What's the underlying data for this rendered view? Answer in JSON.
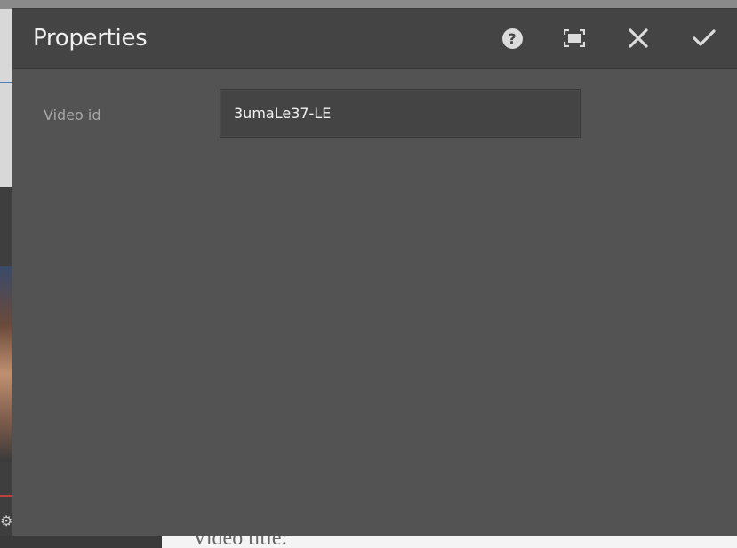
{
  "dialog": {
    "title": "Properties",
    "buttons": {
      "help": "help-icon",
      "fullscreen": "fullscreen-icon",
      "close": "close-icon",
      "done": "checkmark-icon"
    }
  },
  "form": {
    "video_id": {
      "label": "Video id",
      "value": "3umaLe37-LE"
    }
  },
  "background": {
    "partial_text": "Video title:"
  }
}
